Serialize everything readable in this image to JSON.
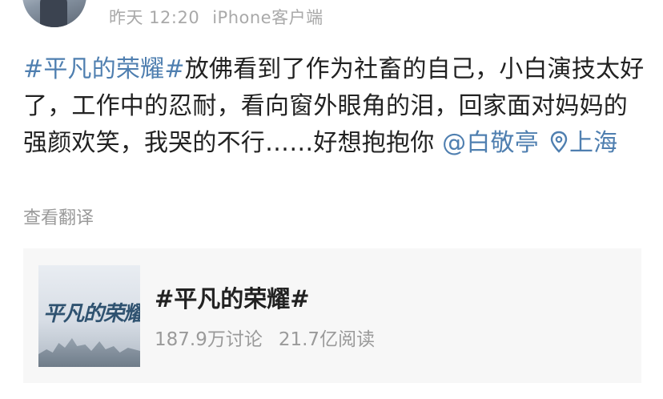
{
  "post": {
    "timestamp": "昨天 12:20",
    "source": "iPhone客户端",
    "topic": "#平凡的荣耀#",
    "body": "放佛看到了作为社畜的自己，小白演技太好了，工作中的忍耐，看向窗外眼角的泪，回家面对妈妈的强颜欢笑，我哭的不行……好想抱抱你",
    "mention": "@白敬亭",
    "location": "上海",
    "translate_label": "查看翻译"
  },
  "topic_card": {
    "cover_text": "平凡的荣耀",
    "title": "#平凡的荣耀#",
    "discussions": "187.9万讨论",
    "reads": "21.7亿阅读"
  },
  "colors": {
    "link": "#4f7fb0",
    "meta": "#a9a9a9",
    "text": "#222222",
    "card_bg": "#f7f7f7"
  }
}
